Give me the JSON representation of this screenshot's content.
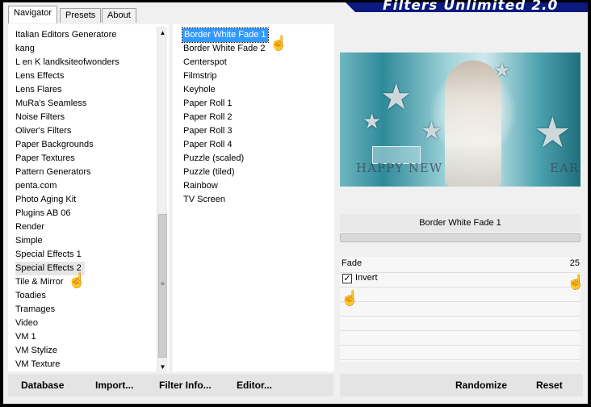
{
  "app_title": "Filters Unlimited 2.0",
  "tabs": [
    {
      "label": "Navigator"
    },
    {
      "label": "Presets"
    },
    {
      "label": "About"
    }
  ],
  "categories": [
    "Italian Editors Generatore",
    "kang",
    "L en K landksiteofwonders",
    "Lens Effects",
    "Lens Flares",
    "MuRa's Seamless",
    "Noise Filters",
    "Oliver's Filters",
    "Paper Backgrounds",
    "Paper Textures",
    "Pattern Generators",
    "penta.com",
    "Photo Aging Kit",
    "Plugins AB 06",
    "Render",
    "Simple",
    "Special Effects 1",
    "Special Effects 2",
    "Tile & Mirror",
    "Toadies",
    "Tramages",
    "Video",
    "VM 1",
    "VM Stylize",
    "VM Texture"
  ],
  "selected_category": "Special Effects 2",
  "filters": [
    "Border White Fade 1",
    "Border White Fade 2",
    "Centerspot",
    "Filmstrip",
    "Keyhole",
    "Paper Roll 1",
    "Paper Roll 2",
    "Paper Roll 3",
    "Paper Roll 4",
    "Puzzle (scaled)",
    "Puzzle (tiled)",
    "Rainbow",
    "TV Screen"
  ],
  "selected_filter": "Border White Fade 1",
  "preview": {
    "text_left": "HAPPY NEW",
    "text_right": "EAR"
  },
  "settings": {
    "title": "Border White Fade 1",
    "fade_label": "Fade",
    "fade_value": "25",
    "invert_label": "Invert",
    "invert_checked": true
  },
  "buttons": {
    "database": "Database",
    "import": "Import...",
    "filter_info": "Filter Info...",
    "editor": "Editor...",
    "randomize": "Randomize",
    "reset": "Reset"
  },
  "colors": {
    "accent": "#0c1a80",
    "selection": "#3399ff"
  }
}
